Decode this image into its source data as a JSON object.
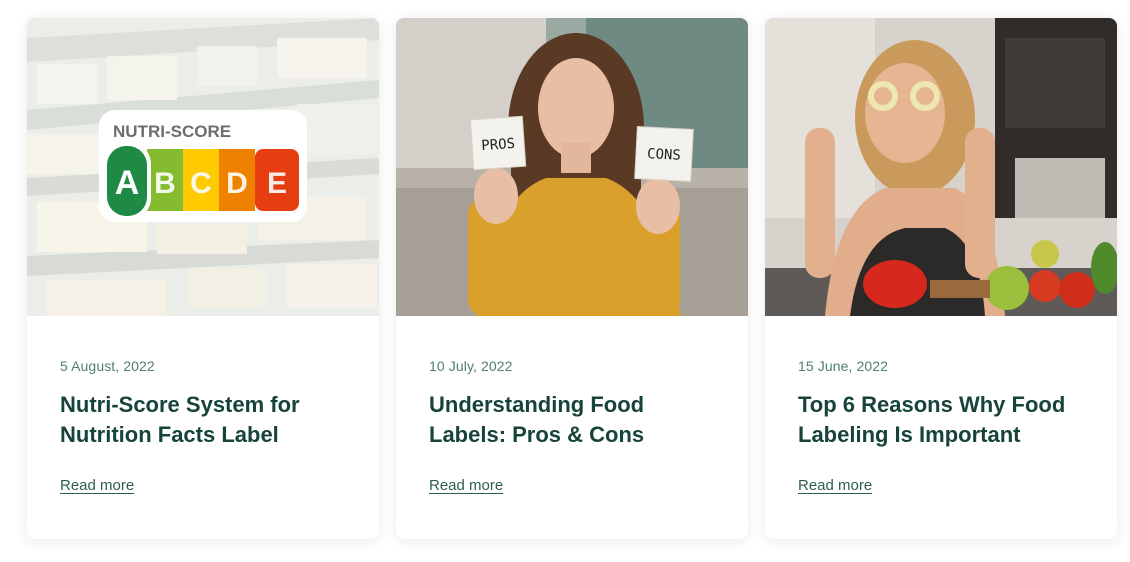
{
  "posts": [
    {
      "image_alt": "nutri-score-label-photo",
      "badge": {
        "heading": "NUTRI-SCORE",
        "grades": [
          "A",
          "B",
          "C",
          "D",
          "E"
        ]
      },
      "date": "5 August, 2022",
      "title": "Nutri-Score System for Nutrition Facts Label",
      "read_more": "Read more"
    },
    {
      "image_alt": "woman-holding-pros-cons-cards-photo",
      "cards": {
        "left": "PROS",
        "right": "CONS"
      },
      "date": "10 July, 2022",
      "title": "Understanding Food Labels: Pros & Cons",
      "read_more": "Read more"
    },
    {
      "image_alt": "woman-with-pepper-rings-photo",
      "date": "15 June, 2022",
      "title": "Top 6 Reasons Why Food Labeling Is Important",
      "read_more": "Read more"
    }
  ],
  "colors": {
    "date": "#4f7f70",
    "title": "#16433a",
    "link": "#2e5e52",
    "nutri_a": "#1e8a44",
    "nutri_b": "#85bb2f",
    "nutri_c": "#fecb02",
    "nutri_d": "#ee8100",
    "nutri_e": "#e63e11"
  }
}
